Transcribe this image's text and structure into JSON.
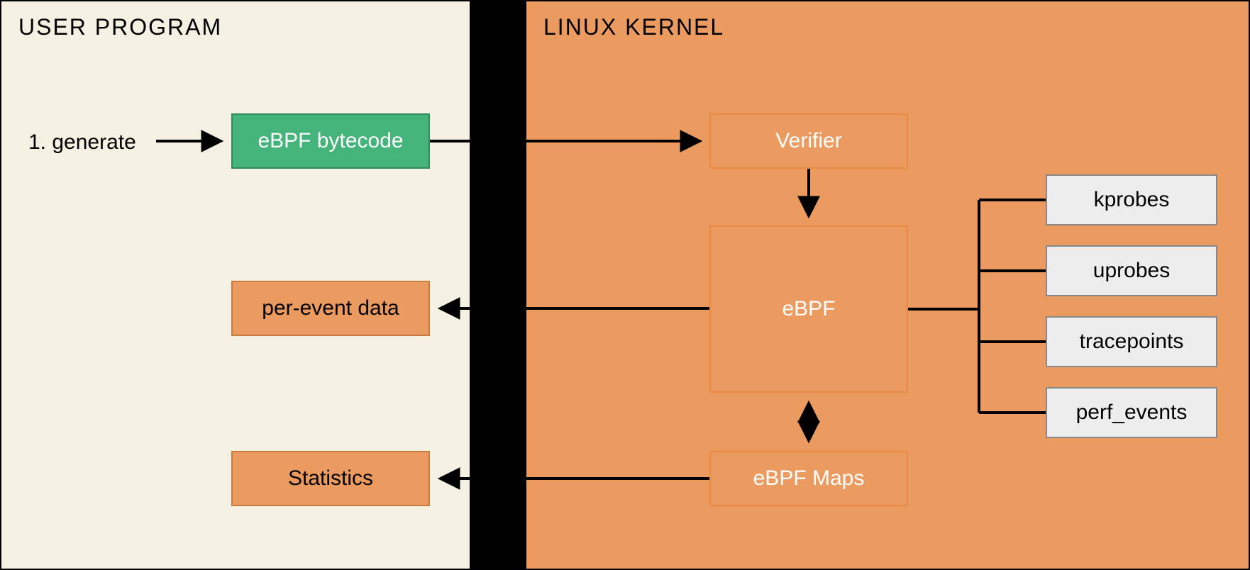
{
  "panels": {
    "user": {
      "title": "USER PROGRAM"
    },
    "kernel": {
      "title": "LINUX KERNEL"
    }
  },
  "step_label": "1. generate",
  "user_boxes": {
    "bytecode": "eBPF bytecode",
    "per_event": "per-event data",
    "statistics": "Statistics"
  },
  "kernel_boxes": {
    "verifier": "Verifier",
    "ebpf": "eBPF",
    "maps": "eBPF Maps"
  },
  "probe_boxes": [
    "kprobes",
    "uprobes",
    "tracepoints",
    "perf_events"
  ]
}
